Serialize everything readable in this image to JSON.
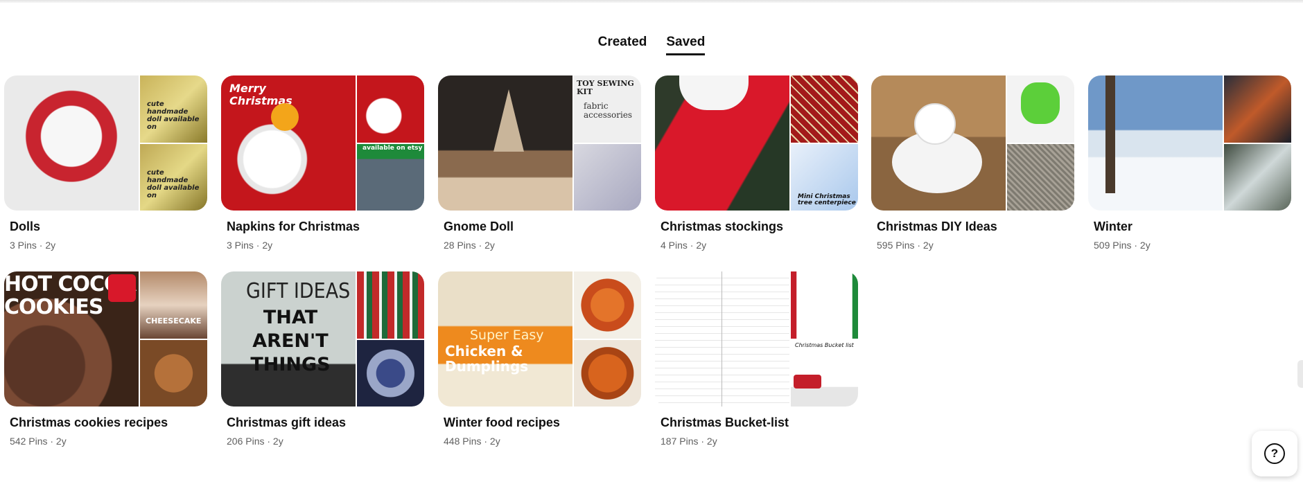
{
  "tabs": [
    {
      "label": "Created",
      "active": false
    },
    {
      "label": "Saved",
      "active": true
    }
  ],
  "boards": [
    {
      "title": "Dolls",
      "meta": "3 Pins · 2y",
      "cover_text": [
        "cute handmade doll available on",
        "cute handmade doll available on"
      ]
    },
    {
      "title": "Napkins for Christmas",
      "meta": "3 Pins · 2y",
      "cover_text": [
        "Merry Christmas",
        "available on etsy"
      ]
    },
    {
      "title": "Gnome Doll",
      "meta": "28 Pins · 2y",
      "cover_text": [
        "TOY SEWING KIT",
        "fabric accessories"
      ]
    },
    {
      "title": "Christmas stockings",
      "meta": "4 Pins · 2y",
      "cover_text": [
        "Mini Christmas tree centerpiece"
      ]
    },
    {
      "title": "Christmas DIY Ideas",
      "meta": "595 Pins · 2y",
      "cover_text": []
    },
    {
      "title": "Winter",
      "meta": "509 Pins · 2y",
      "cover_text": []
    },
    {
      "title": "Christmas cookies recipes",
      "meta": "542 Pins · 2y",
      "cover_text": [
        "HOT COCOA COOKIES",
        "CHEESECAKE"
      ]
    },
    {
      "title": "Christmas gift ideas",
      "meta": "206 Pins · 2y",
      "cover_text": [
        "GIFT IDEAS",
        "THAT AREN'T THINGS"
      ]
    },
    {
      "title": "Winter food recipes",
      "meta": "448 Pins · 2y",
      "cover_text": [
        "Super Easy",
        "Chicken & Dumplings"
      ]
    },
    {
      "title": "Christmas Bucket-list",
      "meta": "187 Pins · 2y",
      "cover_text": [
        "Christmas Bucket list"
      ]
    }
  ],
  "help": {
    "icon": "help-icon",
    "glyph": "?"
  },
  "colors": {
    "text": "#111111",
    "meta": "#5f5f5f",
    "background": "#ffffff"
  }
}
